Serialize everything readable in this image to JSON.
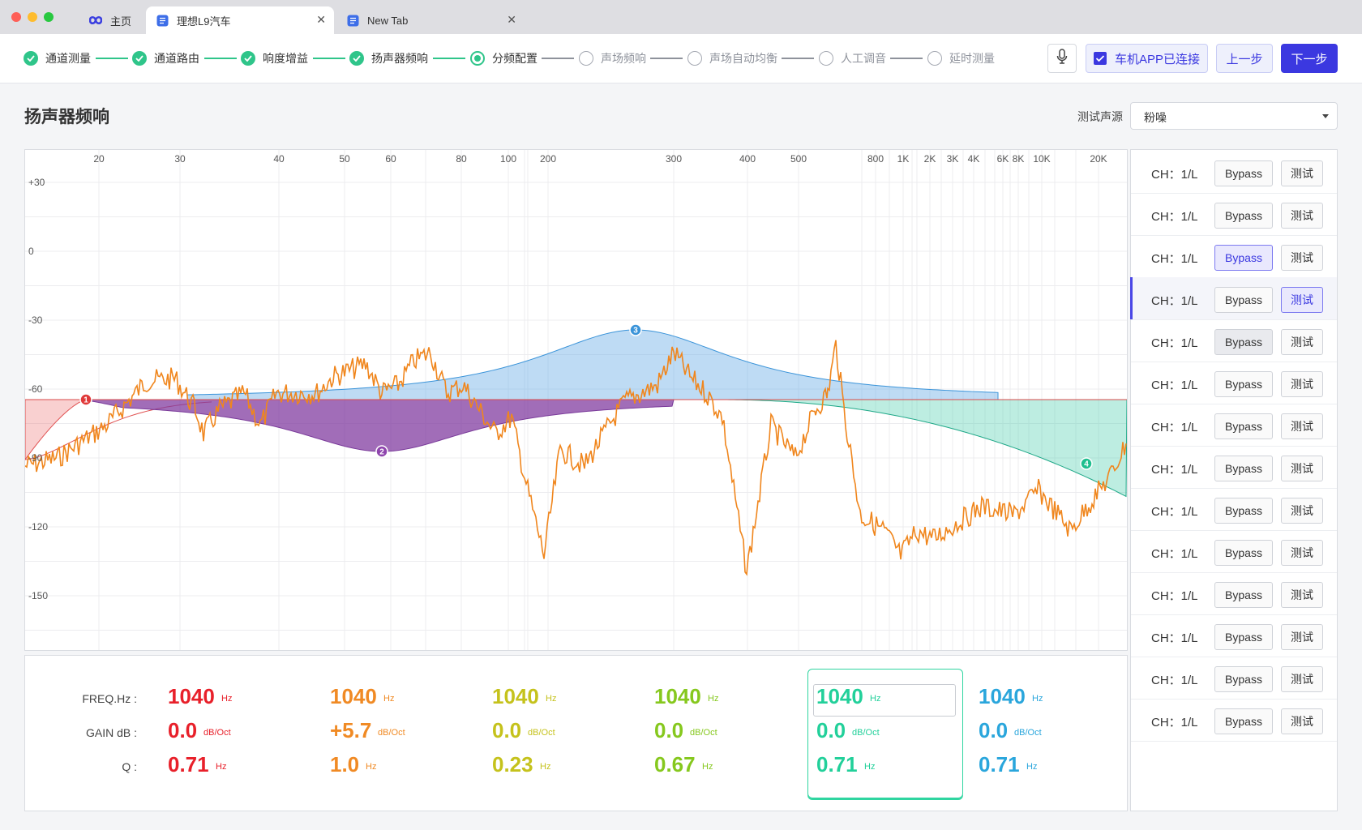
{
  "window": {
    "tabs": [
      {
        "label": "主页",
        "active": false
      },
      {
        "label": "理想L9汽车",
        "active": true
      },
      {
        "label": "New Tab",
        "active": false
      }
    ]
  },
  "steps": [
    {
      "label": "通道测量",
      "state": "done"
    },
    {
      "label": "通道路由",
      "state": "done"
    },
    {
      "label": "响度增益",
      "state": "done"
    },
    {
      "label": "扬声器频响",
      "state": "done"
    },
    {
      "label": "分频配置",
      "state": "current"
    },
    {
      "label": "声场频响",
      "state": "todo"
    },
    {
      "label": "声场自动均衡",
      "state": "todo"
    },
    {
      "label": "人工调音",
      "state": "todo"
    },
    {
      "label": "延时测量",
      "state": "todo"
    }
  ],
  "toolbar": {
    "car_app": "车机APP已连接",
    "prev": "上一步",
    "next": "下一步"
  },
  "page": {
    "title": "扬声器频响",
    "source_label": "测试声源",
    "source_value": "粉噪"
  },
  "chart_data": {
    "type": "line",
    "x_ticks": [
      "20",
      "30",
      "40",
      "50",
      "60",
      "80",
      "100",
      "200",
      "300",
      "400",
      "500",
      "800",
      "1K",
      "2K",
      "3K",
      "4K",
      "6K",
      "8K",
      "10K",
      "20K"
    ],
    "y_ticks": [
      "+30",
      "0",
      "-30",
      "-60",
      "-90",
      "-120",
      "-150"
    ],
    "filter_points": [
      {
        "id": "1",
        "color": "#e03a3a"
      },
      {
        "id": "2",
        "color": "#8e44ad"
      },
      {
        "id": "3",
        "color": "#3b94d9"
      },
      {
        "id": "4",
        "color": "#1fbf8f"
      }
    ]
  },
  "params": {
    "labels": {
      "freq": "FREQ.Hz :",
      "gain": "GAIN dB :",
      "q": "Q :"
    },
    "columns": [
      {
        "freq": "1040",
        "freq_unit": "Hz",
        "gain": "0.0",
        "gain_unit": "dB/Oct",
        "q": "0.71",
        "q_unit": "Hz",
        "color": "#e8202a"
      },
      {
        "freq": "1040",
        "freq_unit": "Hz",
        "gain": "+5.7",
        "gain_unit": "dB/Oct",
        "q": "1.0",
        "q_unit": "Hz",
        "color": "#f08a24"
      },
      {
        "freq": "1040",
        "freq_unit": "Hz",
        "gain": "0.0",
        "gain_unit": "dB/Oct",
        "q": "0.23",
        "q_unit": "Hz",
        "color": "#c5c21c"
      },
      {
        "freq": "1040",
        "freq_unit": "Hz",
        "gain": "0.0",
        "gain_unit": "dB/Oct",
        "q": "0.67",
        "q_unit": "Hz",
        "color": "#86c81e"
      },
      {
        "freq": "1040",
        "freq_unit": "Hz",
        "gain": "0.0",
        "gain_unit": "dB/Oct",
        "q": "0.71",
        "q_unit": "Hz",
        "color": "#22d09a"
      },
      {
        "freq": "1040",
        "freq_unit": "Hz",
        "gain": "0.0",
        "gain_unit": "dB/Oct",
        "q": "0.71",
        "q_unit": "Hz",
        "color": "#2aa6dc"
      }
    ]
  },
  "channels": {
    "bypass_label": "Bypass",
    "test_label": "测试",
    "items": [
      {
        "label": "CH：1/L"
      },
      {
        "label": "CH：1/L"
      },
      {
        "label": "CH：1/L",
        "bypass_on": true
      },
      {
        "label": "CH：1/L",
        "selected": true,
        "test_on": true
      },
      {
        "label": "CH：1/L",
        "bypass_dark": true
      },
      {
        "label": "CH：1/L"
      },
      {
        "label": "CH：1/L"
      },
      {
        "label": "CH：1/L"
      },
      {
        "label": "CH：1/L"
      },
      {
        "label": "CH：1/L"
      },
      {
        "label": "CH：1/L"
      },
      {
        "label": "CH：1/L"
      },
      {
        "label": "CH：1/L"
      },
      {
        "label": "CH：1/L"
      }
    ]
  }
}
